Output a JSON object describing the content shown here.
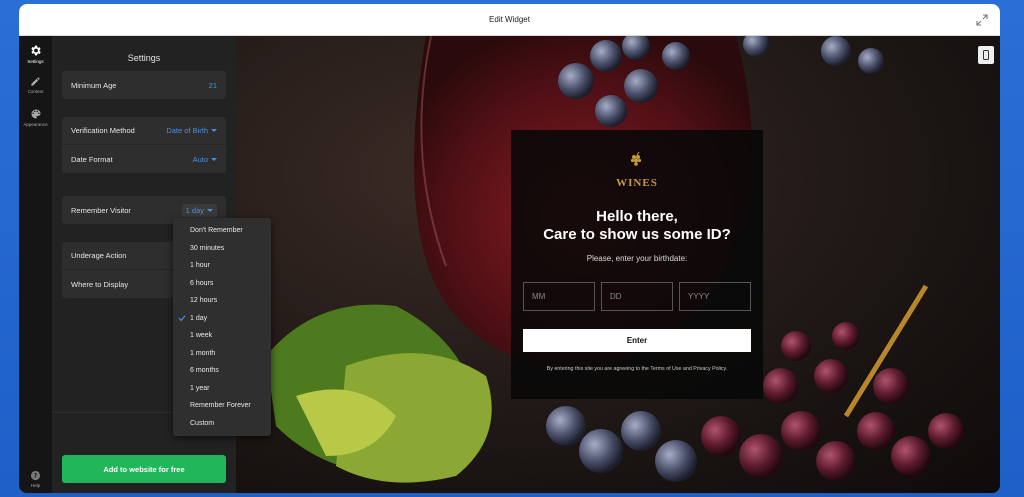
{
  "window": {
    "title": "Edit Widget"
  },
  "iconbar": {
    "items": [
      {
        "label": "Settings",
        "icon": "gear-icon",
        "active": true
      },
      {
        "label": "Content",
        "icon": "pencil-icon",
        "active": false
      },
      {
        "label": "Appearance",
        "icon": "palette-icon",
        "active": false
      }
    ],
    "help_label": "Help"
  },
  "settings": {
    "title": "Settings",
    "minimum_age": {
      "label": "Minimum Age",
      "value": "21"
    },
    "verification_method": {
      "label": "Verification Method",
      "value": "Date of Birth"
    },
    "date_format": {
      "label": "Date Format",
      "value": "Auto"
    },
    "remember_visitor": {
      "label": "Remember Visitor",
      "value": "1 day"
    },
    "underage_action": {
      "label": "Underage Action"
    },
    "where_to_display": {
      "label": "Where to Display"
    },
    "add_button": "Add to website for free"
  },
  "dropdown": {
    "options": [
      "Don't Remember",
      "30 minutes",
      "1 hour",
      "6 hours",
      "12 hours",
      "1 day",
      "1 week",
      "1 month",
      "6 months",
      "1 year",
      "Remember Forever",
      "Custom"
    ],
    "selected": "1 day"
  },
  "modal": {
    "logo_text": "WINES",
    "heading_line1": "Hello there,",
    "heading_line2": "Care to show us some ID?",
    "subtitle": "Please, enter your birthdate:",
    "month_placeholder": "MM",
    "day_placeholder": "DD",
    "year_placeholder": "YYYY",
    "enter_label": "Enter",
    "terms": "By entering this site you are agreeing to the Terms of Use and Privacy Policy."
  },
  "colors": {
    "accent": "#4a90e2",
    "cta_green": "#21b65a",
    "logo_gold": "#c99a3c",
    "panel_bg": "#222222"
  }
}
